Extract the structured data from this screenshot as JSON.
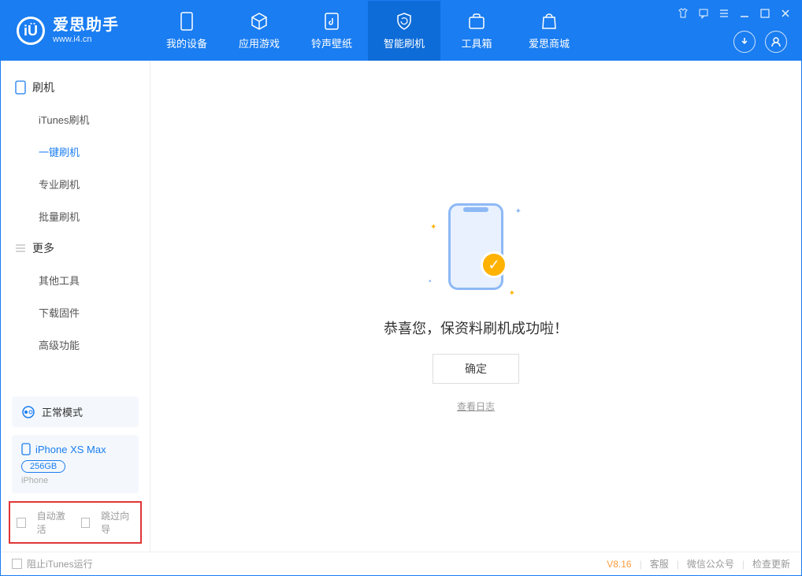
{
  "app": {
    "title": "爱思助手",
    "subtitle": "www.i4.cn"
  },
  "header_tabs": {
    "device": "我的设备",
    "apps": "应用游戏",
    "ringtones": "铃声壁纸",
    "flash": "智能刷机",
    "toolbox": "工具箱",
    "store": "爱思商城"
  },
  "sidebar": {
    "section_flash": "刷机",
    "items_flash": {
      "itunes": "iTunes刷机",
      "onekey": "一键刷机",
      "pro": "专业刷机",
      "batch": "批量刷机"
    },
    "section_more": "更多",
    "items_more": {
      "other": "其他工具",
      "firmware": "下载固件",
      "advanced": "高级功能"
    },
    "mode": "正常模式",
    "device": {
      "name": "iPhone XS Max",
      "capacity": "256GB",
      "type": "iPhone"
    },
    "opts": {
      "auto_activate": "自动激活",
      "skip_guide": "跳过向导"
    }
  },
  "main": {
    "success": "恭喜您，保资料刷机成功啦！",
    "ok": "确定",
    "view_log": "查看日志"
  },
  "footer": {
    "block_itunes": "阻止iTunes运行",
    "version": "V8.16",
    "support": "客服",
    "wechat": "微信公众号",
    "update": "检查更新"
  }
}
